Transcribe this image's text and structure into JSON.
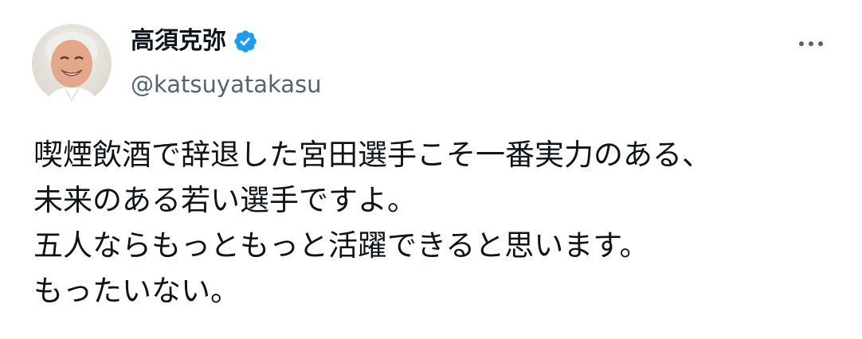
{
  "user": {
    "display_name": "高須克弥",
    "handle": "@katsuyatakasu",
    "verified": true,
    "verified_icon": "verified-badge-icon",
    "avatar_icon": "avatar"
  },
  "more_icon": "more-horizontal-icon",
  "tweet": {
    "lines": [
      "喫煙飲酒で辞退した宮田選手こそ一番実力のある、",
      "未来のある若い選手ですよ。",
      "五人ならもっともっと活躍できると思います。",
      "もったいない。"
    ]
  },
  "colors": {
    "text": "#0f1419",
    "secondary": "#536471",
    "verified_blue": "#1d9bf0",
    "background": "#ffffff"
  }
}
